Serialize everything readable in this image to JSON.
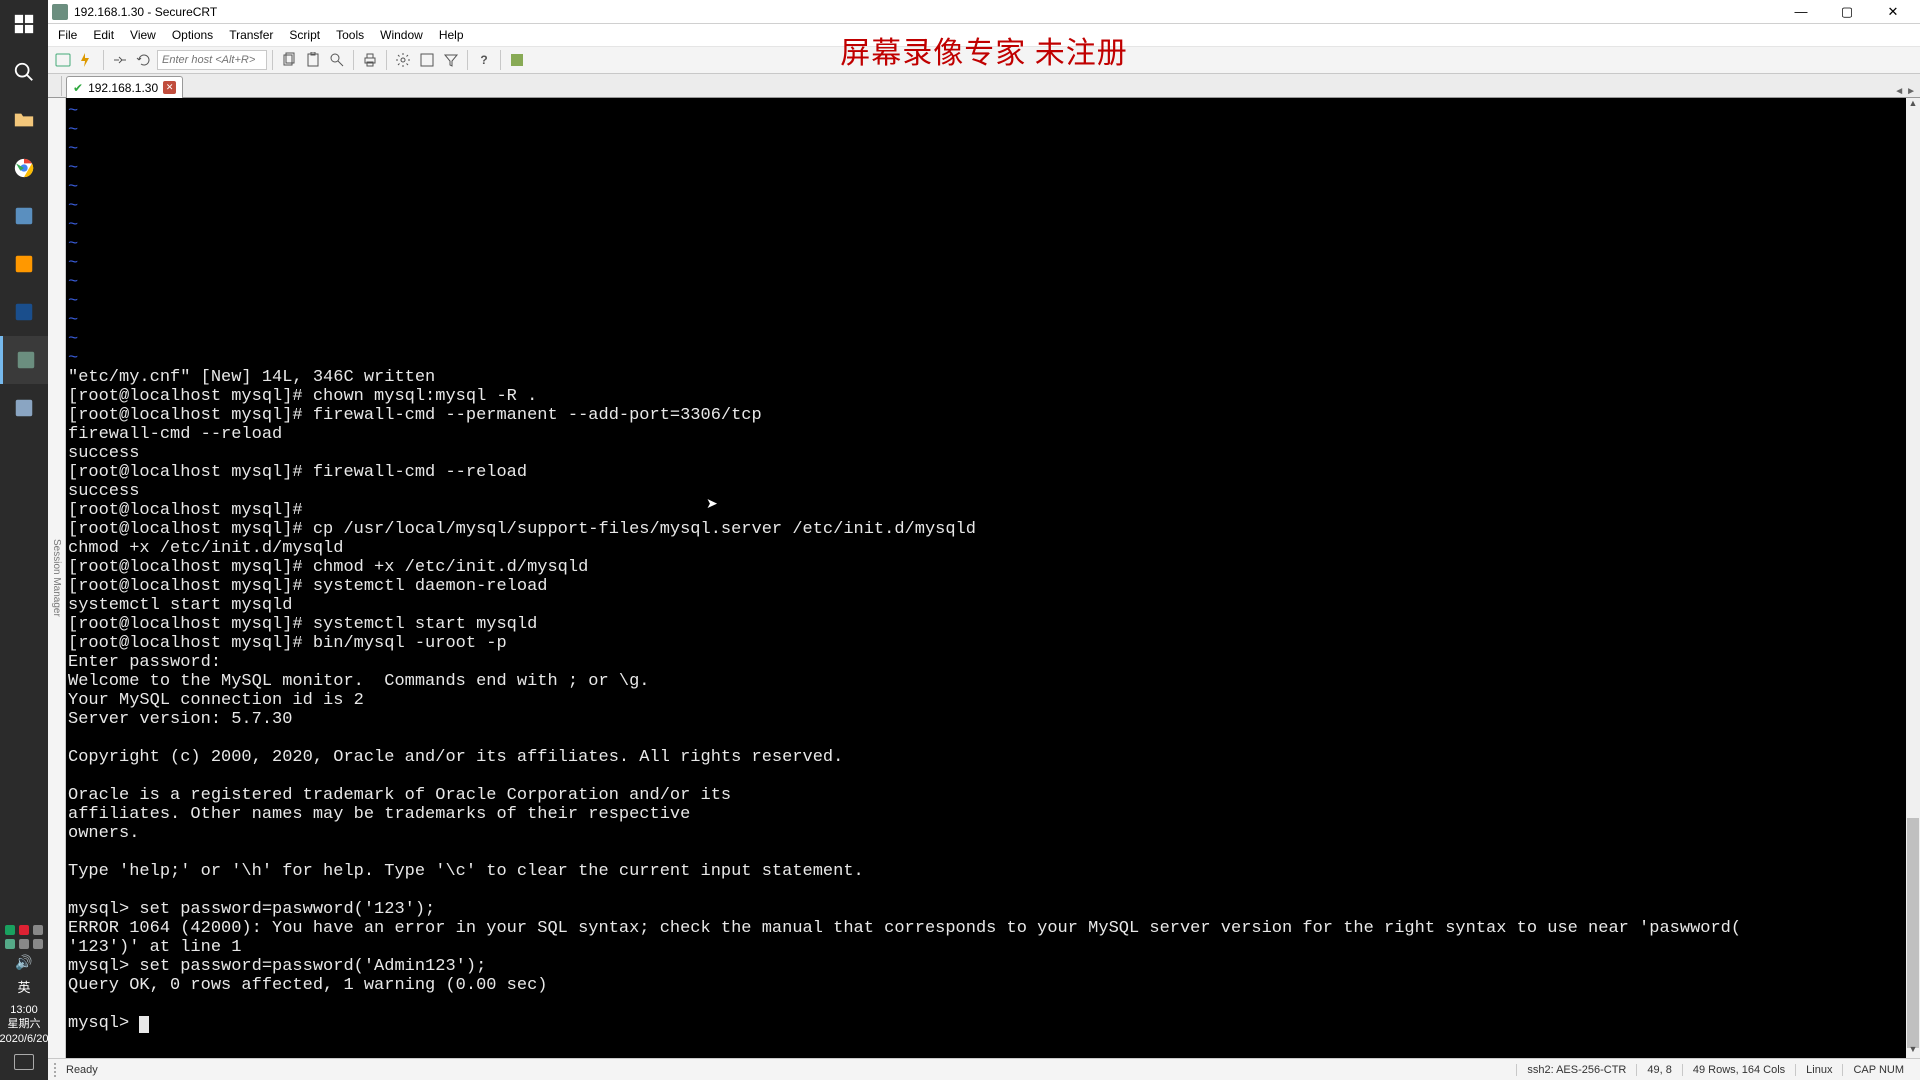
{
  "window": {
    "title": "192.168.1.30 - SecureCRT"
  },
  "menus": [
    "File",
    "Edit",
    "View",
    "Options",
    "Transfer",
    "Script",
    "Tools",
    "Window",
    "Help"
  ],
  "watermark": "屏幕录像专家 未注册",
  "toolbar": {
    "host_placeholder": "Enter host <Alt+R>"
  },
  "tab": {
    "label": "192.168.1.30"
  },
  "sidebar": {
    "label": "Session Manager"
  },
  "terminal": {
    "lines": [
      "~",
      "~",
      "~",
      "~",
      "~",
      "~",
      "~",
      "~",
      "~",
      "~",
      "~",
      "~",
      "~",
      "~",
      "\"etc/my.cnf\" [New] 14L, 346C written",
      "[root@localhost mysql]# chown mysql:mysql -R .",
      "[root@localhost mysql]# firewall-cmd --permanent --add-port=3306/tcp",
      "firewall-cmd --reload",
      "success",
      "[root@localhost mysql]# firewall-cmd --reload",
      "success",
      "[root@localhost mysql]#",
      "[root@localhost mysql]# cp /usr/local/mysql/support-files/mysql.server /etc/init.d/mysqld",
      "chmod +x /etc/init.d/mysqld",
      "[root@localhost mysql]# chmod +x /etc/init.d/mysqld",
      "[root@localhost mysql]# systemctl daemon-reload",
      "systemctl start mysqld",
      "[root@localhost mysql]# systemctl start mysqld",
      "[root@localhost mysql]# bin/mysql -uroot -p",
      "Enter password:",
      "Welcome to the MySQL monitor.  Commands end with ; or \\g.",
      "Your MySQL connection id is 2",
      "Server version: 5.7.30",
      "",
      "Copyright (c) 2000, 2020, Oracle and/or its affiliates. All rights reserved.",
      "",
      "Oracle is a registered trademark of Oracle Corporation and/or its",
      "affiliates. Other names may be trademarks of their respective",
      "owners.",
      "",
      "Type 'help;' or '\\h' for help. Type '\\c' to clear the current input statement.",
      "",
      "mysql> set password=paswword('123');",
      "ERROR 1064 (42000): You have an error in your SQL syntax; check the manual that corresponds to your MySQL server version for the right syntax to use near 'paswword(",
      "'123')' at line 1",
      "mysql> set password=password('Admin123');",
      "Query OK, 0 rows affected, 1 warning (0.00 sec)",
      "",
      "mysql> "
    ]
  },
  "status": {
    "ready": "Ready",
    "ssh": "ssh2: AES-256-CTR",
    "pos": "49,    8",
    "size": "49 Rows, 164 Cols",
    "term": "Linux",
    "caps": "CAP  NUM"
  },
  "tray": {
    "lang": "英",
    "time": "13:00",
    "day": "星期六",
    "date": "2020/6/20"
  }
}
